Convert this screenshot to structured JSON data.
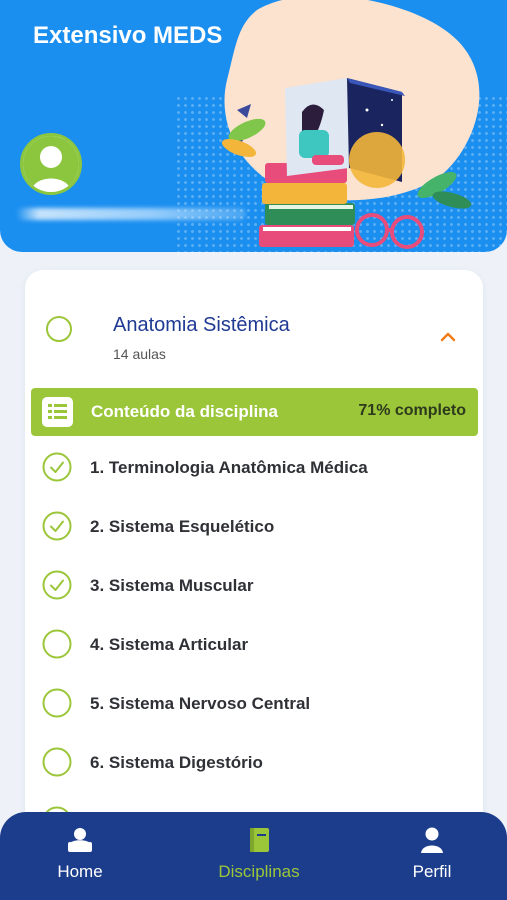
{
  "header": {
    "title": "Extensivo MEDS"
  },
  "discipline": {
    "title": "Anatomia Sistêmica",
    "subtitle": "14 aulas"
  },
  "content_bar": {
    "label": "Conteúdo da disciplina",
    "progress_text": "71% completo",
    "progress_value": 71
  },
  "lessons": [
    {
      "label": "1. Terminologia Anatômica Médica",
      "completed": true
    },
    {
      "label": "2. Sistema Esquelético",
      "completed": true
    },
    {
      "label": "3. Sistema Muscular",
      "completed": true
    },
    {
      "label": "4. Sistema Articular",
      "completed": false
    },
    {
      "label": "5. Sistema Nervoso Central",
      "completed": false
    },
    {
      "label": "6. Sistema Digestório",
      "completed": false
    }
  ],
  "nav": [
    {
      "label": "Home",
      "icon": "home-icon",
      "active": false
    },
    {
      "label": "Disciplinas",
      "icon": "book-icon",
      "active": true
    },
    {
      "label": "Perfil",
      "icon": "profile-icon",
      "active": false
    }
  ],
  "colors": {
    "header_bg": "#1b8ff0",
    "accent_green": "#9cc63a",
    "nav_bg": "#1c3d8c",
    "discipline_title": "#1f3a93",
    "chevron": "#f07d1a"
  }
}
